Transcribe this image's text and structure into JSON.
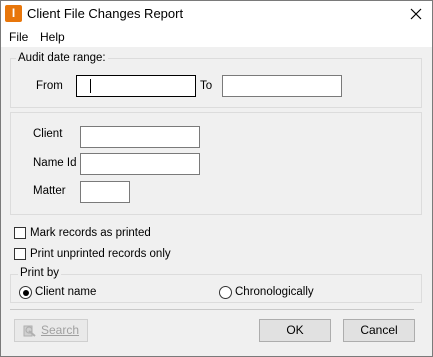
{
  "window": {
    "title": "Client File Changes Report",
    "icon_letter": "I"
  },
  "menu": {
    "items": [
      "File",
      "Help"
    ]
  },
  "audit": {
    "legend": "Audit date range:",
    "from_label": "From",
    "to_label": "To",
    "from_value": "",
    "to_value": ""
  },
  "filters": {
    "client_label": "Client",
    "name_id_label": "Name Id",
    "matter_label": "Matter",
    "client_value": "",
    "name_id_value": "",
    "matter_value": ""
  },
  "options": {
    "mark_printed_label": "Mark records as printed",
    "mark_printed_checked": false,
    "unprinted_only_label": "Print unprinted records only",
    "unprinted_only_checked": false
  },
  "print_by": {
    "legend": "Print by",
    "client_name_label": "Client name",
    "chronologically_label": "Chronologically",
    "selected": "Client name"
  },
  "buttons": {
    "search": "Search",
    "ok": "OK",
    "cancel": "Cancel"
  },
  "colors": {
    "app_icon": "#e8760a",
    "window_bg": "#f0f0f0"
  }
}
